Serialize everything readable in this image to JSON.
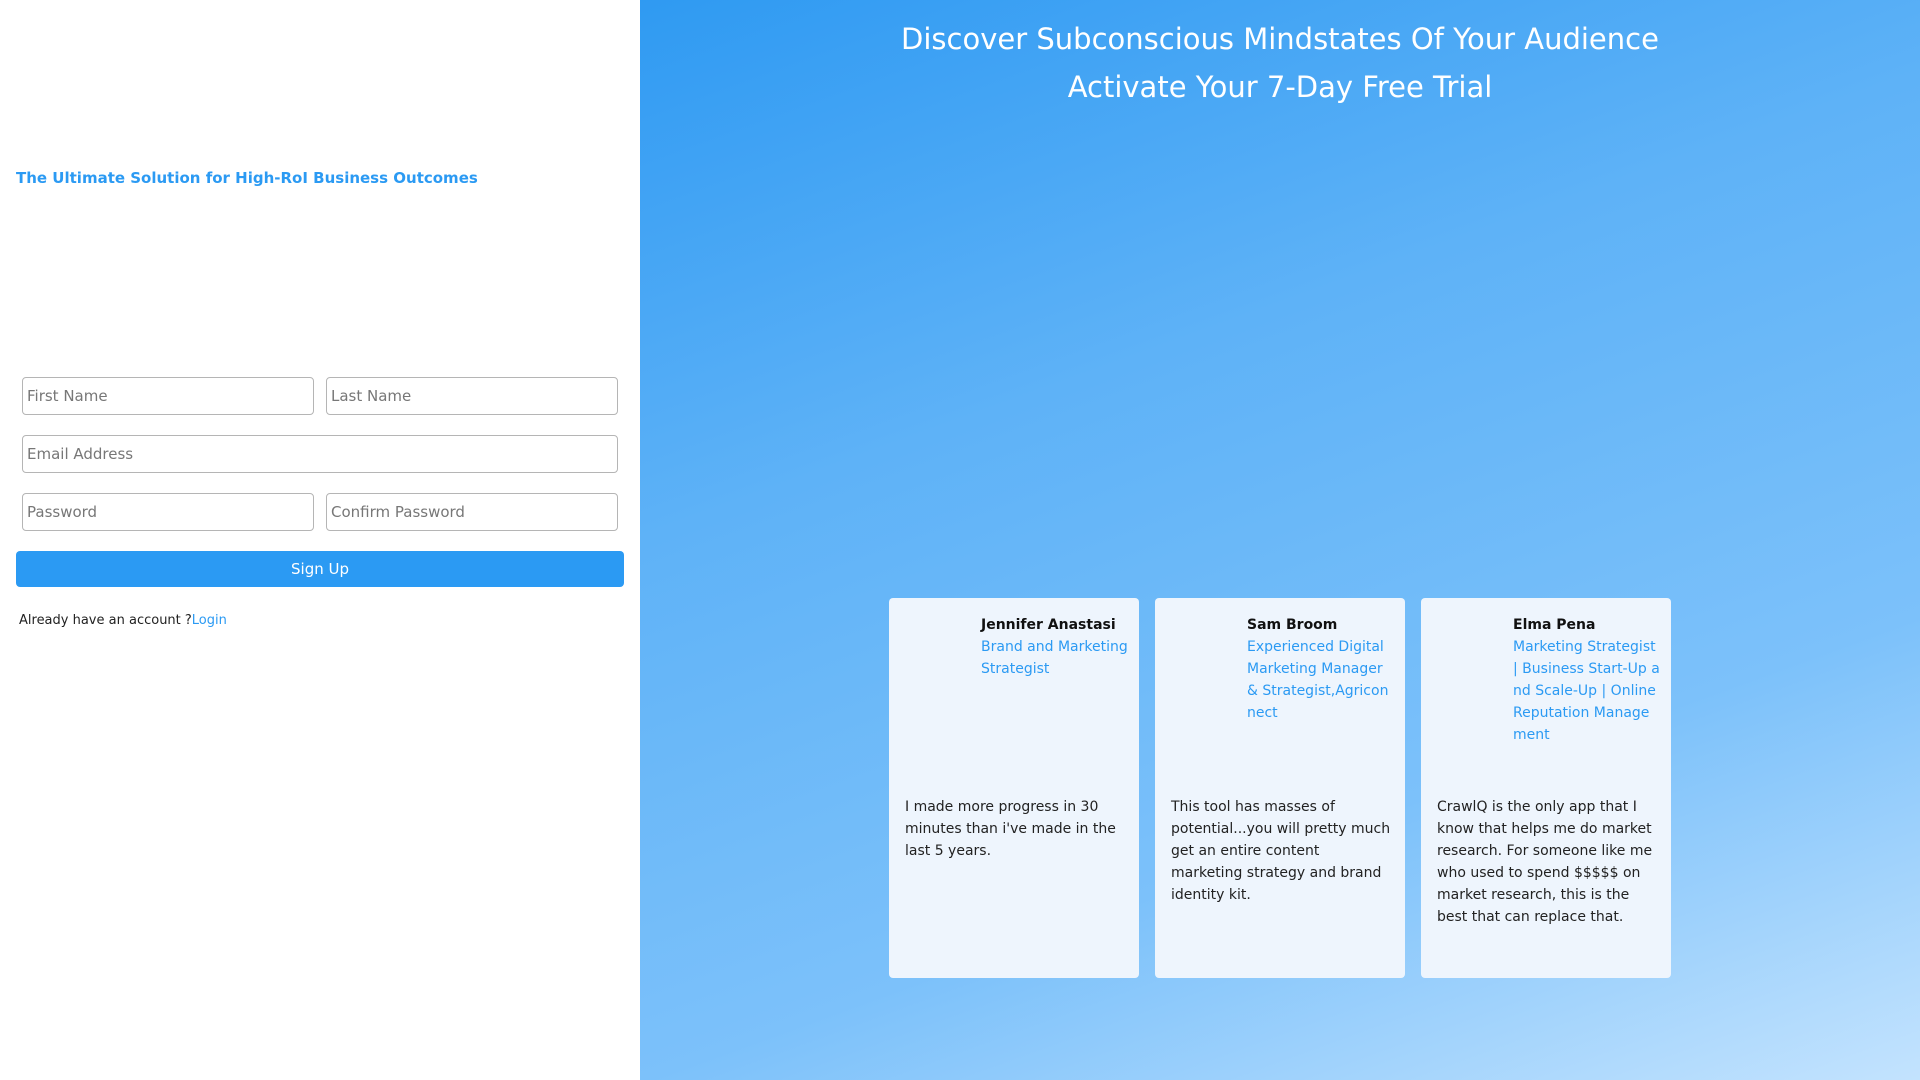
{
  "left": {
    "tagline": "The Ultimate Solution for High-RoI Business Outcomes",
    "form": {
      "first_name_placeholder": "First Name",
      "last_name_placeholder": "Last Name",
      "email_placeholder": "Email Address",
      "password_placeholder": "Password",
      "confirm_password_placeholder": "Confirm Password",
      "signup_label": "Sign Up"
    },
    "login_prompt": "Already have an account ?",
    "login_link": "Login"
  },
  "right": {
    "headline_1": "Discover Subconscious Mindstates Of Your Audience",
    "headline_2": "Activate Your 7-Day Free Trial",
    "testimonials": [
      {
        "name": "Jennifer Anastasi",
        "role": "Brand and Marketing Strategist",
        "quote": "I made more progress in 30 minutes than i've made in the last 5 years."
      },
      {
        "name": "Sam Broom",
        "role": "Experienced Digital Marketing Manager & Strategist,Agriconnect",
        "quote": "This tool has masses of potential...you will pretty much get an entire content marketing strategy and brand identity kit."
      },
      {
        "name": "Elma Pena",
        "role": "Marketing Strategist | Business Start-Up and Scale-Up | Online Reputation Management",
        "quote": "CrawlQ is the only app that I know that helps me do market research. For someone like me who used to spend $$$$$ on market research, this is the best that can replace that."
      }
    ]
  },
  "colors": {
    "accent": "#2b9af3",
    "card_bg": "#eef5fd"
  }
}
